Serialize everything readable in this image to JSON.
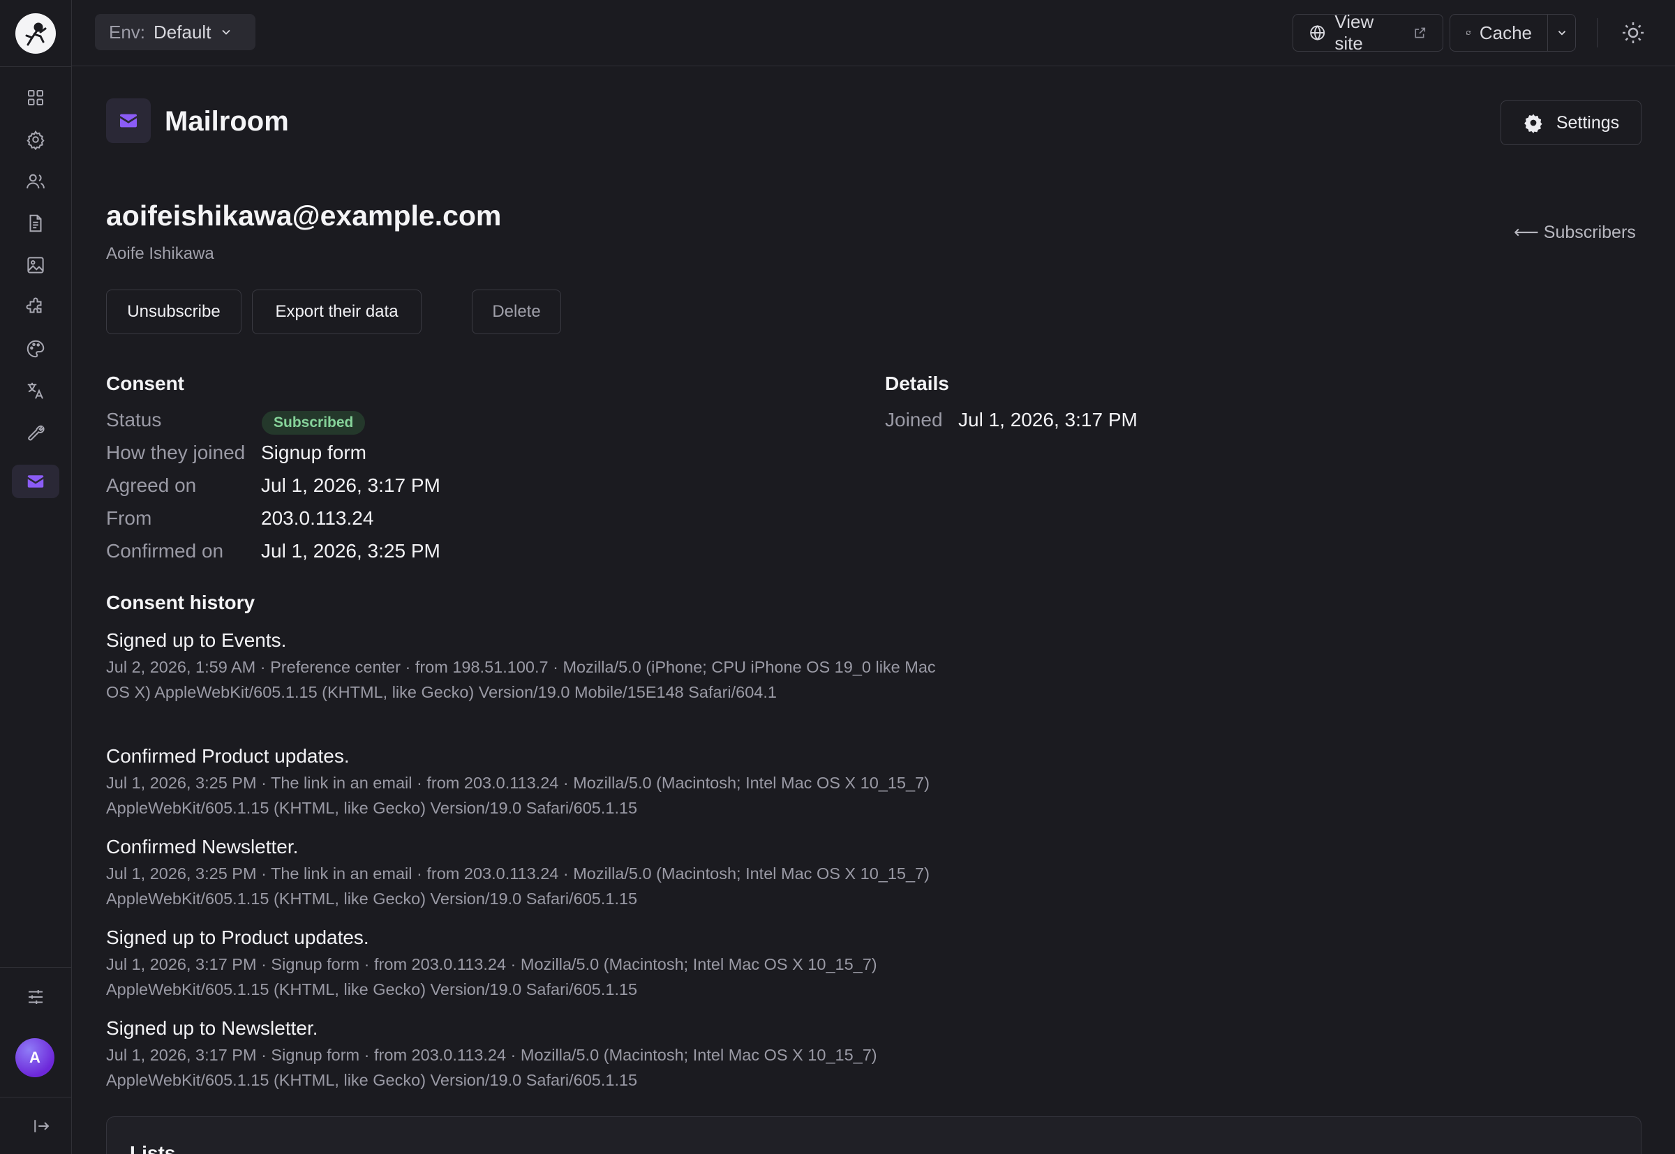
{
  "topbar": {
    "env_label": "Env:",
    "env_value": "Default",
    "view_site": "View site",
    "cache": "Cache"
  },
  "app": {
    "title": "Mailroom",
    "settings_label": "Settings"
  },
  "subscriber": {
    "email": "aoifeishikawa@example.com",
    "name": "Aoife Ishikawa",
    "back_link": "⟵ Subscribers"
  },
  "actions": {
    "unsubscribe": "Unsubscribe",
    "export": "Export their data",
    "delete": "Delete"
  },
  "consent": {
    "heading": "Consent",
    "status_label": "Status",
    "status_value": "Subscribed",
    "joined_how_label": "How they joined",
    "joined_how_value": "Signup form",
    "agreed_label": "Agreed on",
    "agreed_value": "Jul 1, 2026, 3:17 PM",
    "from_label": "From",
    "from_value": "203.0.113.24",
    "confirmed_label": "Confirmed on",
    "confirmed_value": "Jul 1, 2026, 3:25 PM"
  },
  "details": {
    "heading": "Details",
    "joined_label": "Joined",
    "joined_value": "Jul 1, 2026, 3:17 PM"
  },
  "history": {
    "heading": "Consent history",
    "items": [
      {
        "title": "Signed up to Events.",
        "meta": "Jul 2, 2026, 1:59 AM · Preference center · from 198.51.100.7 · Mozilla/5.0 (iPhone; CPU iPhone OS 19_0 like Mac OS X) AppleWebKit/605.1.15 (KHTML, like Gecko) Version/19.0 Mobile/15E148 Safari/604.1"
      },
      {
        "title": "Confirmed Product updates.",
        "meta": "Jul 1, 2026, 3:25 PM · The link in an email · from 203.0.113.24 · Mozilla/5.0 (Macintosh; Intel Mac OS X 10_15_7) AppleWebKit/605.1.15 (KHTML, like Gecko) Version/19.0 Safari/605.1.15"
      },
      {
        "title": "Confirmed Newsletter.",
        "meta": "Jul 1, 2026, 3:25 PM · The link in an email · from 203.0.113.24 · Mozilla/5.0 (Macintosh; Intel Mac OS X 10_15_7) AppleWebKit/605.1.15 (KHTML, like Gecko) Version/19.0 Safari/605.1.15"
      },
      {
        "title": "Signed up to Product updates.",
        "meta": "Jul 1, 2026, 3:17 PM · Signup form · from 203.0.113.24 · Mozilla/5.0 (Macintosh; Intel Mac OS X 10_15_7) AppleWebKit/605.1.15 (KHTML, like Gecko) Version/19.0 Safari/605.1.15"
      },
      {
        "title": "Signed up to Newsletter.",
        "meta": "Jul 1, 2026, 3:17 PM · Signup form · from 203.0.113.24 · Mozilla/5.0 (Macintosh; Intel Mac OS X 10_15_7) AppleWebKit/605.1.15 (KHTML, like Gecko) Version/19.0 Safari/605.1.15"
      }
    ]
  },
  "lists": {
    "heading": "Lists"
  },
  "user": {
    "avatar_initial": "A"
  },
  "colors": {
    "accent": "#8b5cf6",
    "background": "#1b1b20",
    "badge_bg": "#24382b",
    "badge_text": "#86d39a"
  },
  "icons": {
    "sidebar": [
      "dashboard-icon",
      "gear-icon",
      "users-icon",
      "document-icon",
      "image-icon",
      "puzzle-icon",
      "palette-icon",
      "translate-icon",
      "wrench-icon",
      "mail-icon"
    ],
    "footer": [
      "sliders-icon",
      "collapse-sidebar-icon"
    ]
  }
}
